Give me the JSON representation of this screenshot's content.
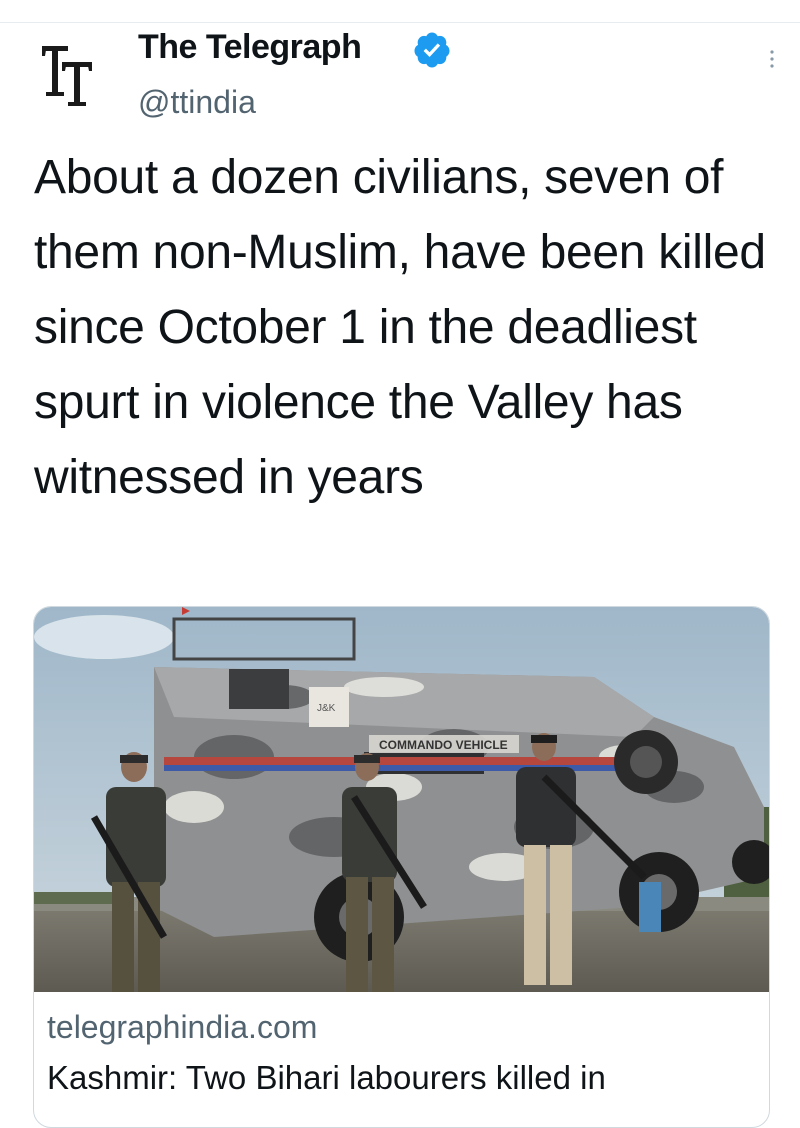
{
  "account": {
    "name": "The Telegraph",
    "handle": "@ttindia",
    "logo_text": "TT",
    "verified": true
  },
  "tweet": {
    "text": "About a dozen civilians, seven of them non-Muslim, have been killed since October 1 in the deadliest spurt in violence the Valley has witnessed in years"
  },
  "card": {
    "domain": "telegraphindia.com",
    "title": "Kashmir: Two Bihari labourers killed in",
    "image_text": {
      "vehicle_label": "COMMANDO VEHICLE",
      "emblem": "J&K"
    }
  },
  "colors": {
    "text_primary": "#0f1419",
    "text_secondary": "#536471",
    "verified_blue": "#1d9bf0",
    "border": "#cfd9de"
  },
  "icons": {
    "verified": "verified-badge-icon",
    "more": "more-vertical-icon"
  }
}
